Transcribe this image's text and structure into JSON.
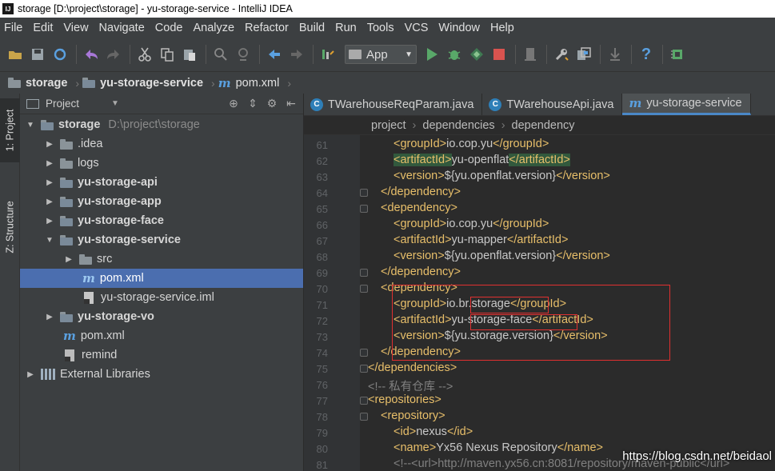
{
  "window": {
    "title": "storage [D:\\project\\storage] - yu-storage-service - IntelliJ IDEA",
    "app_icon": "IJ"
  },
  "menu": [
    "File",
    "Edit",
    "View",
    "Navigate",
    "Code",
    "Analyze",
    "Refactor",
    "Build",
    "Run",
    "Tools",
    "VCS",
    "Window",
    "Help"
  ],
  "toolbar": {
    "run_config": "App"
  },
  "navbar": {
    "root": "storage",
    "module": "yu-storage-service",
    "file": "pom.xml"
  },
  "sidebar_tabs": {
    "project": "1: Project",
    "structure": "Z: Structure"
  },
  "project_panel": {
    "title": "Project",
    "tree": [
      {
        "label": "storage",
        "path": "D:\\project\\storage"
      },
      {
        "label": ".idea"
      },
      {
        "label": "logs"
      },
      {
        "label": "yu-storage-api"
      },
      {
        "label": "yu-storage-app"
      },
      {
        "label": "yu-storage-face"
      },
      {
        "label": "yu-storage-service"
      },
      {
        "label": "src"
      },
      {
        "label": "pom.xml"
      },
      {
        "label": "yu-storage-service.iml"
      },
      {
        "label": "yu-storage-vo"
      },
      {
        "label": "pom.xml"
      },
      {
        "label": "remind"
      },
      {
        "label": "External Libraries"
      }
    ]
  },
  "editor": {
    "tabs": [
      "TWarehouseReqParam.java",
      "TWarehouseApi.java",
      "yu-storage-service"
    ],
    "breadcrumb": [
      "project",
      "dependencies",
      "dependency"
    ],
    "lines": [
      {
        "n": "61",
        "open": "<groupId>",
        "text": "io.cop.yu",
        "close": "</groupId>"
      },
      {
        "n": "62",
        "open": "<artifactId>",
        "text": "yu-openflat",
        "close": "</artifactId>"
      },
      {
        "n": "63",
        "open": "<version>",
        "text": "${yu.openflat.version}",
        "close": "</version>"
      },
      {
        "n": "64",
        "open": "</dependency>",
        "text": "",
        "close": ""
      },
      {
        "n": "65",
        "open": "<dependency>",
        "text": "",
        "close": ""
      },
      {
        "n": "66",
        "open": "<groupId>",
        "text": "io.cop.yu",
        "close": "</groupId>"
      },
      {
        "n": "67",
        "open": "<artifactId>",
        "text": "yu-mapper",
        "close": "</artifactId>"
      },
      {
        "n": "68",
        "open": "<version>",
        "text": "${yu.openflat.version}",
        "close": "</version>"
      },
      {
        "n": "69",
        "open": "</dependency>",
        "text": "",
        "close": ""
      },
      {
        "n": "70",
        "open": "<dependency>",
        "text": "",
        "close": ""
      },
      {
        "n": "71",
        "open": "<groupId>",
        "text": "io.br.storage",
        "close": "</groupId>"
      },
      {
        "n": "72",
        "open": "<artifactId>",
        "text": "yu-storage-face",
        "close": "</artifactId>"
      },
      {
        "n": "73",
        "open": "<version>",
        "text": "${yu.storage.version}",
        "close": "</version>"
      },
      {
        "n": "74",
        "open": "</dependency>",
        "text": "",
        "close": ""
      },
      {
        "n": "75",
        "open": "</dependencies>",
        "text": "",
        "close": ""
      },
      {
        "n": "76",
        "comment": "<!-- 私有仓库 -->"
      },
      {
        "n": "77",
        "open": "<repositories>",
        "text": "",
        "close": ""
      },
      {
        "n": "78",
        "open": "<repository>",
        "text": "",
        "close": ""
      },
      {
        "n": "79",
        "open": "<id>",
        "text": "nexus",
        "close": "</id>"
      },
      {
        "n": "80",
        "open": "<name>",
        "text": "Yx56 Nexus Repository",
        "close": "</name>"
      },
      {
        "n": "81",
        "comment": "<!--<url>http://maven.yx56.cn:8081/repository/maven-public</url>"
      }
    ]
  },
  "watermark": "https://blog.csdn.net/beidaol",
  "colors": {
    "tag": "#e8bf6a",
    "text": "#c8c8c8",
    "comment": "#808080",
    "highlight_box": "#e03030",
    "selection": "#4b6eaf"
  }
}
